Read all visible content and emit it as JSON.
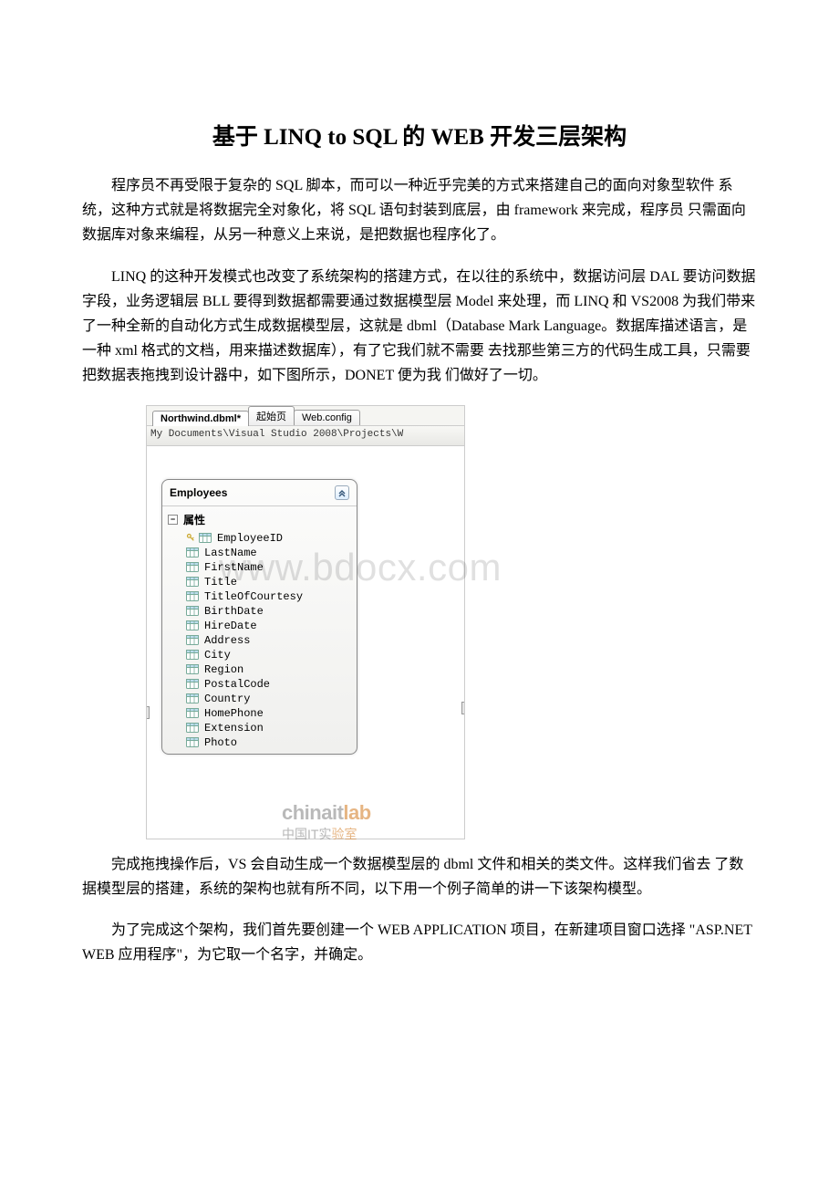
{
  "title": "基于 LINQ to SQL 的 WEB 开发三层架构",
  "para1": "程序员不再受限于复杂的 SQL 脚本，而可以一种近乎完美的方式来搭建自己的面向对象型软件 系统，这种方式就是将数据完全对象化，将 SQL 语句封装到底层，由 framework 来完成，程序员 只需面向数据库对象来编程，从另一种意义上来说，是把数据也程序化了。",
  "para2": "LINQ 的这种开发模式也改变了系统架构的搭建方式，在以往的系统中，数据访问层 DAL 要访问数据字段，业务逻辑层 BLL 要得到数据都需要通过数据模型层 Model 来处理，而 LINQ 和 VS2008 为我们带来了一种全新的自动化方式生成数据模型层，这就是 dbml（Database Mark Language。数据库描述语言，是一种 xml 格式的文档，用来描述数据库），有了它我们就不需要 去找那些第三方的代码生成工具，只需要把数据表拖拽到设计器中，如下图所示，DONET 便为我 们做好了一切。",
  "para3": "完成拖拽操作后，VS 会自动生成一个数据模型层的 dbml 文件和相关的类文件。这样我们省去 了数据模型层的搭建，系统的架构也就有所不同，以下用一个例子简单的讲一下该架构模型。",
  "para4": "为了完成这个架构，我们首先要创建一个 WEB APPLICATION 项目，在新建项目窗口选择 \"ASP.NET WEB 应用程序\"，为它取一个名字，并确定。",
  "screenshot": {
    "tabs": [
      {
        "label": "Northwind.dbml*",
        "active": true
      },
      {
        "label": "起始页",
        "active": false
      },
      {
        "label": "Web.config",
        "active": false
      }
    ],
    "path": "My Documents\\Visual Studio 2008\\Projects\\W",
    "entity": {
      "name": "Employees",
      "section": "属性",
      "fields": [
        {
          "name": "EmployeeID",
          "key": true
        },
        {
          "name": "LastName"
        },
        {
          "name": "FirstName"
        },
        {
          "name": "Title"
        },
        {
          "name": "TitleOfCourtesy"
        },
        {
          "name": "BirthDate"
        },
        {
          "name": "HireDate"
        },
        {
          "name": "Address"
        },
        {
          "name": "City"
        },
        {
          "name": "Region"
        },
        {
          "name": "PostalCode"
        },
        {
          "name": "Country"
        },
        {
          "name": "HomePhone"
        },
        {
          "name": "Extension"
        },
        {
          "name": "Photo"
        }
      ]
    }
  },
  "watermark": {
    "big": "www.bdocx.com",
    "brand1a": "chinait",
    "brand1b": "lab",
    "brand2a": "中国IT实",
    "brand2b": "验室"
  }
}
